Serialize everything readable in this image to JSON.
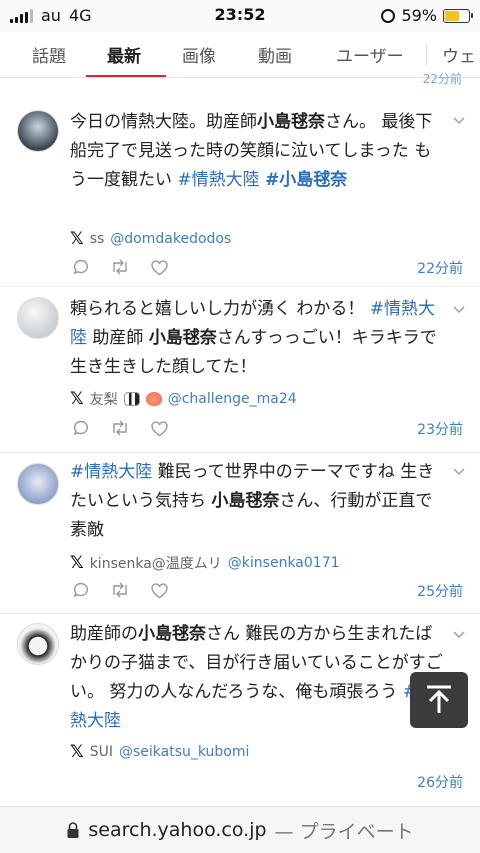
{
  "status": {
    "carrier": "au",
    "network": "4G",
    "time": "23:52",
    "battery": "59%",
    "battery_level": 0.59
  },
  "tabs": [
    {
      "label": "話題",
      "active": false
    },
    {
      "label": "最新",
      "active": true
    },
    {
      "label": "画像",
      "active": false
    },
    {
      "label": "動画",
      "active": false
    },
    {
      "label": "ユーザー",
      "active": false
    },
    {
      "label": "ウェ",
      "active": false
    }
  ],
  "previous_time": "22分前",
  "posts": [
    {
      "text_parts": [
        {
          "t": "今日の情熱大陸。助産師"
        },
        {
          "t": "小島毬奈",
          "s": "b"
        },
        {
          "t": "さん。 最後下船完了で見送った時の笑顔に泣いてしまった もう一度観たい "
        },
        {
          "t": "#情熱大陸",
          "s": "tag"
        },
        {
          "t": " "
        },
        {
          "t": "#小島毬奈",
          "s": "tagb"
        }
      ],
      "author_name": "ss",
      "handle": "@domdakedodos",
      "time": "22分前"
    },
    {
      "text_parts": [
        {
          "t": "頼られると嬉しいし力が湧く わかる！ "
        },
        {
          "t": "#情熱大陸",
          "s": "tag"
        },
        {
          "t": " 助産師 "
        },
        {
          "t": "小島毬奈",
          "s": "b"
        },
        {
          "t": "さんすっっごい！キラキラで生き生きした顔してた！"
        }
      ],
      "author_name": "友梨",
      "handle": "@challenge_ma24",
      "time": "23分前"
    },
    {
      "text_parts": [
        {
          "t": "#情熱大陸",
          "s": "tag"
        },
        {
          "t": " 難民って世界中のテーマですね 生きたいという気持ち "
        },
        {
          "t": "小島毬奈",
          "s": "b"
        },
        {
          "t": "さん、行動が正直で素敵"
        }
      ],
      "author_name": "kinsenka@温度ムリ",
      "handle": "@kinsenka0171",
      "time": "25分前"
    },
    {
      "text_parts": [
        {
          "t": "助産師の"
        },
        {
          "t": "小島毬奈",
          "s": "b"
        },
        {
          "t": "さん 難民の方から生まれたばかりの子猫まで、目が行き届いていることがすごい。 努力の人なんだろうな、俺も頑張ろう "
        },
        {
          "t": "#情熱大陸",
          "s": "tag"
        }
      ],
      "author_name": "SUI",
      "handle": "@seikatsu_kubomi",
      "time": "26分前"
    }
  ],
  "url": {
    "domain": "search.yahoo.co.jp",
    "mode": "— プライベート"
  }
}
